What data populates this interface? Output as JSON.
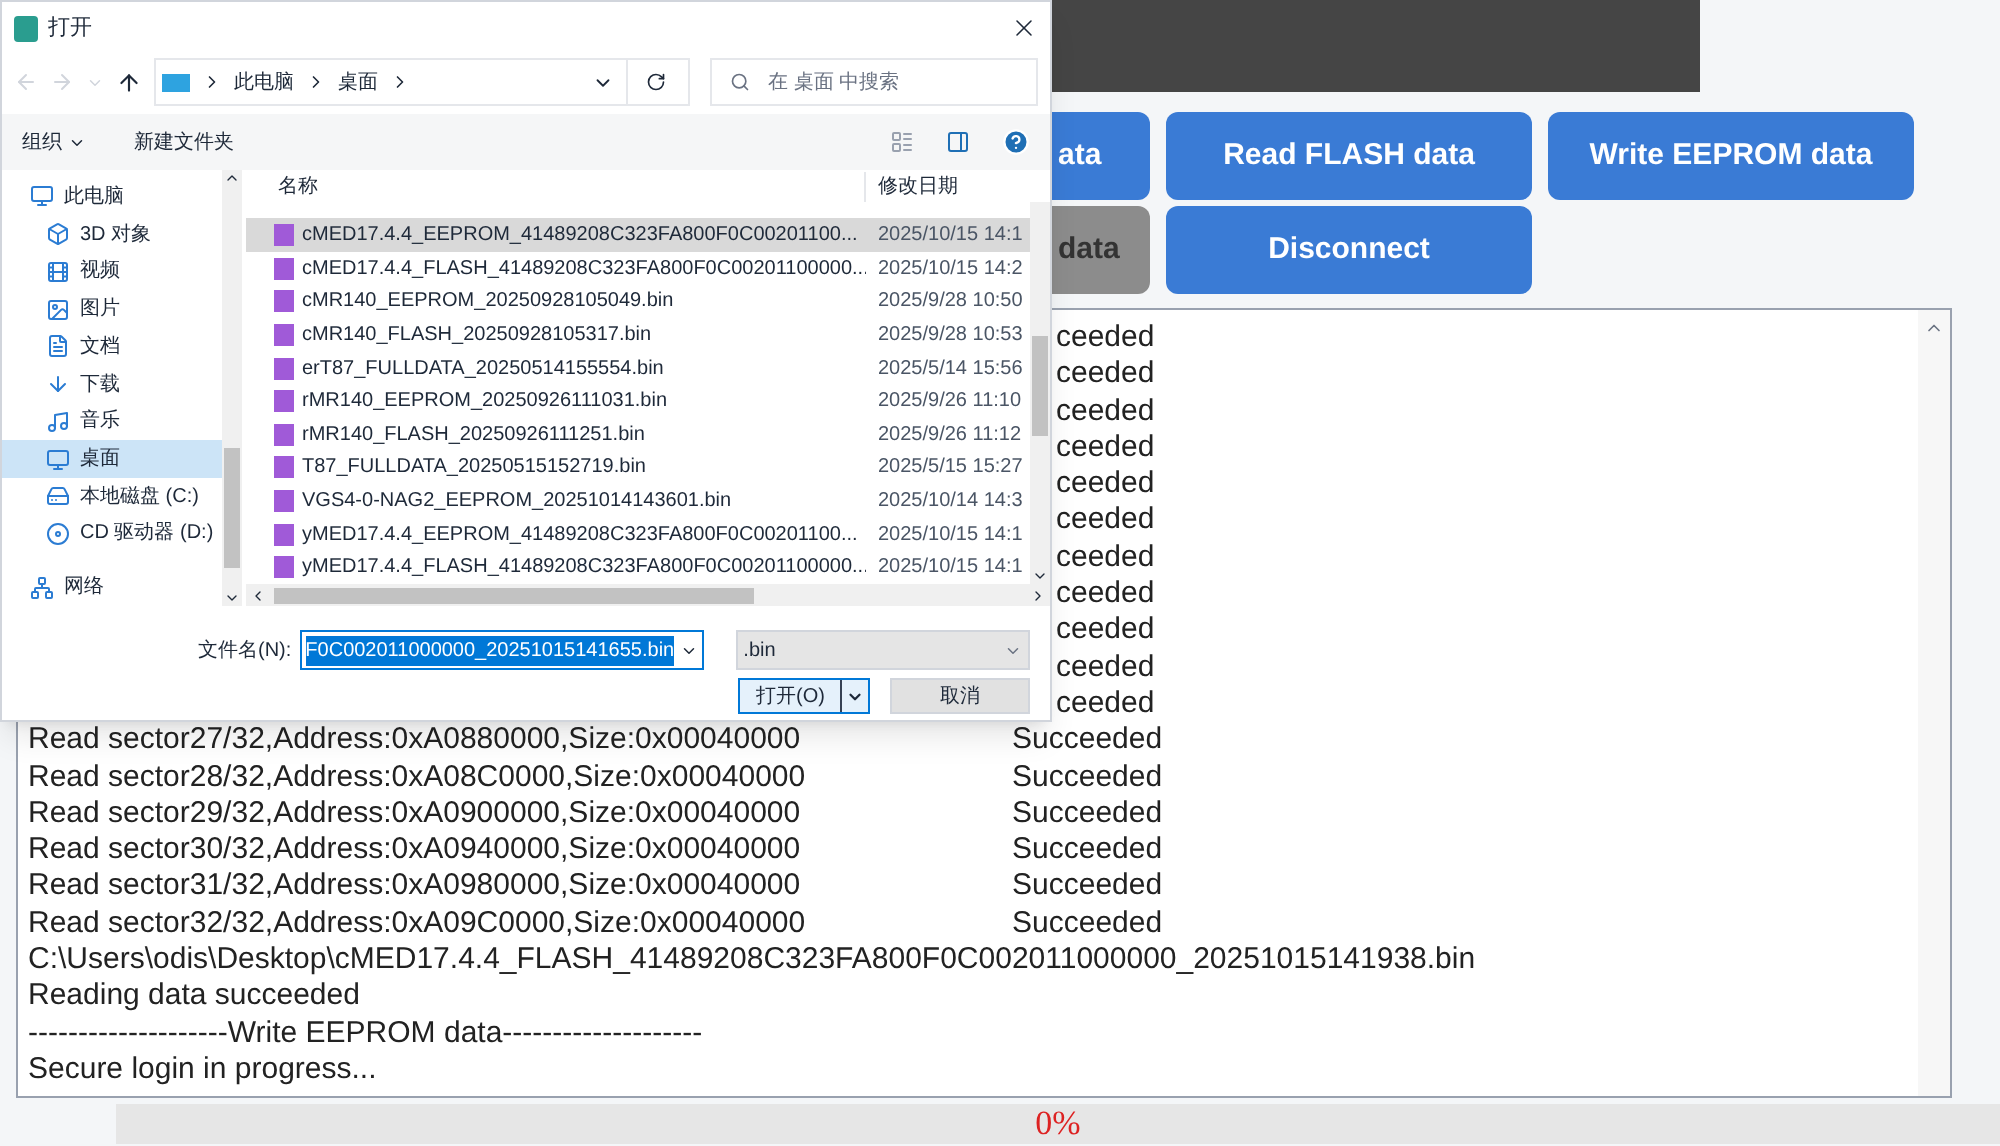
{
  "dialog": {
    "title": "打开",
    "path": [
      "此电脑",
      "桌面"
    ],
    "search_placeholder": "在 桌面 中搜索",
    "organize": "组织",
    "new_folder": "新建文件夹",
    "sidebar": [
      {
        "label": "此电脑",
        "kind": "pc",
        "selected": false
      },
      {
        "label": "3D 对象",
        "kind": "cube",
        "selected": false
      },
      {
        "label": "视频",
        "kind": "video",
        "selected": false
      },
      {
        "label": "图片",
        "kind": "image",
        "selected": false
      },
      {
        "label": "文档",
        "kind": "doc",
        "selected": false
      },
      {
        "label": "下载",
        "kind": "download",
        "selected": false
      },
      {
        "label": "音乐",
        "kind": "music",
        "selected": false
      },
      {
        "label": "桌面",
        "kind": "desktop",
        "selected": true
      },
      {
        "label": "本地磁盘 (C:)",
        "kind": "disk",
        "selected": false
      },
      {
        "label": "CD 驱动器 (D:)",
        "kind": "cd",
        "selected": false
      },
      {
        "label": "网络",
        "kind": "network",
        "selected": false
      }
    ],
    "columns": [
      "名称",
      "修改日期"
    ],
    "files": [
      {
        "name": "cMED17.4.4_EEPROM_41489208C323FA800F0C00201100...",
        "date": "2025/10/15 14:1",
        "selected": true
      },
      {
        "name": "cMED17.4.4_FLASH_41489208C323FA800F0C00201100000...",
        "date": "2025/10/15 14:2",
        "selected": false
      },
      {
        "name": "cMR140_EEPROM_20250928105049.bin",
        "date": "2025/9/28 10:50",
        "selected": false
      },
      {
        "name": "cMR140_FLASH_20250928105317.bin",
        "date": "2025/9/28 10:53",
        "selected": false
      },
      {
        "name": "erT87_FULLDATA_20250514155554.bin",
        "date": "2025/5/14 15:56",
        "selected": false
      },
      {
        "name": "rMR140_EEPROM_20250926111031.bin",
        "date": "2025/9/26 11:10",
        "selected": false
      },
      {
        "name": "rMR140_FLASH_20250926111251.bin",
        "date": "2025/9/26 11:12",
        "selected": false
      },
      {
        "name": "T87_FULLDATA_20250515152719.bin",
        "date": "2025/5/15 15:27",
        "selected": false
      },
      {
        "name": "VGS4-0-NAG2_EEPROM_20251014143601.bin",
        "date": "2025/10/14 14:3",
        "selected": false
      },
      {
        "name": "yMED17.4.4_EEPROM_41489208C323FA800F0C00201100...",
        "date": "2025/10/15 14:1",
        "selected": false
      },
      {
        "name": "yMED17.4.4_FLASH_41489208C323FA800F0C00201100000...",
        "date": "2025/10/15 14:1",
        "selected": false
      }
    ],
    "filename_label": "文件名(N):",
    "filename_value": "F0C002011000000_20251015141655.bin",
    "filter": ".bin",
    "open_button": "打开(O)",
    "cancel_button": "取消"
  },
  "app": {
    "button_rows": [
      [
        {
          "label": "ata",
          "disabled": false
        },
        {
          "label": "Read FLASH data",
          "disabled": false
        },
        {
          "label": "Write EEPROM data",
          "disabled": false
        }
      ],
      [
        {
          "label": "data",
          "disabled": true
        },
        {
          "label": "Disconnect",
          "disabled": false
        }
      ]
    ],
    "log": [
      {
        "kind": "covered",
        "status": "ceeded"
      },
      {
        "kind": "covered",
        "status": "ceeded"
      },
      {
        "kind": "covered",
        "status": "ceeded"
      },
      {
        "kind": "covered",
        "status": "ceeded"
      },
      {
        "kind": "covered",
        "status": "ceeded"
      },
      {
        "kind": "covered",
        "status": "ceeded"
      },
      {
        "kind": "covered",
        "status": "ceeded"
      },
      {
        "kind": "covered",
        "status": "ceeded"
      },
      {
        "kind": "covered",
        "status": "ceeded"
      },
      {
        "kind": "covered",
        "status": "ceeded"
      },
      {
        "kind": "covered",
        "status": "ceeded"
      },
      {
        "kind": "entry",
        "text": "Read sector27/32,Address:0xA0880000,Size:0x00040000",
        "status": "Succeeded"
      },
      {
        "kind": "entry",
        "text": "Read sector28/32,Address:0xA08C0000,Size:0x00040000",
        "status": "Succeeded"
      },
      {
        "kind": "entry",
        "text": "Read sector29/32,Address:0xA0900000,Size:0x00040000",
        "status": "Succeeded"
      },
      {
        "kind": "entry",
        "text": "Read sector30/32,Address:0xA0940000,Size:0x00040000",
        "status": "Succeeded"
      },
      {
        "kind": "entry",
        "text": "Read sector31/32,Address:0xA0980000,Size:0x00040000",
        "status": "Succeeded"
      },
      {
        "kind": "entry",
        "text": "Read sector32/32,Address:0xA09C0000,Size:0x00040000",
        "status": "Succeeded"
      },
      {
        "kind": "line",
        "text": "C:\\Users\\odis\\Desktop\\cMED17.4.4_FLASH_41489208C323FA800F0C002011000000_20251015141938.bin"
      },
      {
        "kind": "line",
        "text": "Reading data succeeded"
      },
      {
        "kind": "line",
        "text": "--------------------Write EEPROM data--------------------"
      },
      {
        "kind": "line",
        "text": "Secure login in progress..."
      }
    ],
    "progress": {
      "label": "0%",
      "level": 0
    }
  }
}
